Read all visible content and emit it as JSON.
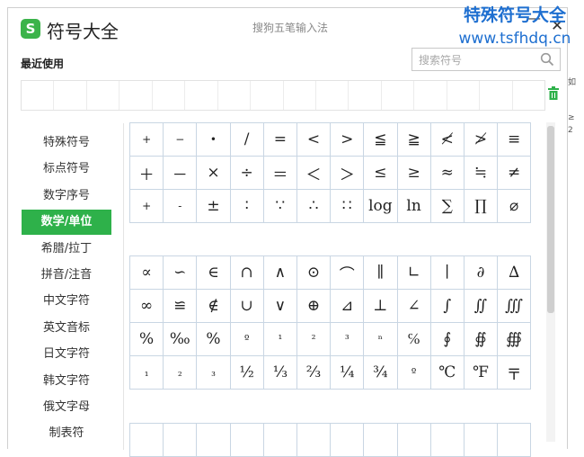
{
  "window": {
    "title": "符号大全",
    "ime_name": "搜狗五笔输入法",
    "minimize": "—",
    "close": "✕"
  },
  "logo": "S",
  "recent": {
    "label": "最近使用",
    "cells": 16
  },
  "search": {
    "placeholder": "搜索符号"
  },
  "sidebar": {
    "items": [
      {
        "label": "特殊符号"
      },
      {
        "label": "标点符号"
      },
      {
        "label": "数字序号"
      },
      {
        "label": "数学/单位",
        "active": true
      },
      {
        "label": "希腊/拉丁"
      },
      {
        "label": "拼音/注音"
      },
      {
        "label": "中文字符"
      },
      {
        "label": "英文音标"
      },
      {
        "label": "日文字符"
      },
      {
        "label": "韩文字符"
      },
      {
        "label": "俄文字母"
      },
      {
        "label": "制表符"
      }
    ]
  },
  "grid1": [
    [
      "+",
      "−",
      "•",
      "/",
      "=",
      "<",
      ">",
      "≦",
      "≧",
      "≮",
      "≯",
      "≡"
    ],
    [
      "＋",
      "－",
      "×",
      "÷",
      "＝",
      "＜",
      "＞",
      "≤",
      "≥",
      "≈",
      "≒",
      "≠"
    ],
    [
      "+",
      "-",
      "±",
      "∶",
      "∵",
      "∴",
      "∷",
      "log",
      "ln",
      "∑",
      "∏",
      "⌀"
    ]
  ],
  "grid2": [
    [
      "∝",
      "∽",
      "∈",
      "∩",
      "∧",
      "⊙",
      "⌒",
      "∥",
      "∟",
      "∣",
      "∂",
      "∆"
    ],
    [
      "∞",
      "≌",
      "∉",
      "∪",
      "∨",
      "⊕",
      "⊿",
      "⊥",
      "∠",
      "∫",
      "∬",
      "∭"
    ],
    [
      "%",
      "‰",
      "%",
      "º",
      "¹",
      "²",
      "³",
      "ⁿ",
      "℅",
      "∮",
      "∯",
      "∰"
    ],
    [
      "₁",
      "₂",
      "₃",
      "½",
      "⅓",
      "⅔",
      "¼",
      "¾",
      "º",
      "℃",
      "℉",
      "〒"
    ]
  ],
  "watermark": {
    "line1": "特殊符号大全",
    "line2": "www.tsfhdq.cn"
  },
  "side_stubs": [
    "如",
    "≥",
    "2"
  ]
}
